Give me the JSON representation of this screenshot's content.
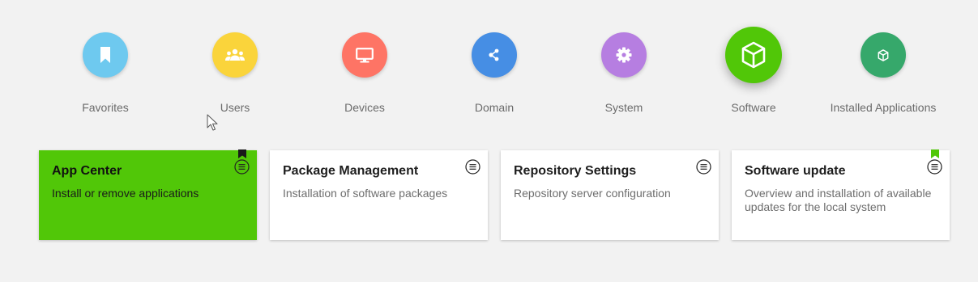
{
  "categories": [
    {
      "id": "favorites",
      "label": "Favorites",
      "color": "#6ec9ef",
      "icon": "bookmark-icon"
    },
    {
      "id": "users",
      "label": "Users",
      "color": "#fad43b",
      "icon": "users-icon"
    },
    {
      "id": "devices",
      "label": "Devices",
      "color": "#fe7465",
      "icon": "monitor-icon"
    },
    {
      "id": "domain",
      "label": "Domain",
      "color": "#468ee4",
      "icon": "network-icon"
    },
    {
      "id": "system",
      "label": "System",
      "color": "#b67ee1",
      "icon": "gear-icon"
    },
    {
      "id": "software",
      "label": "Software",
      "color": "#51c708",
      "icon": "cube-icon",
      "selected": true
    },
    {
      "id": "installed",
      "label": "Installed Applications",
      "color": "#36a86b",
      "icon": "cube-icon"
    }
  ],
  "tiles": [
    {
      "title": "App Center",
      "description": "Install or remove applications",
      "selected": true,
      "bookmark": "bookmark-icon-dark"
    },
    {
      "title": "Package Management",
      "description": "Installation of software packages"
    },
    {
      "title": "Repository Settings",
      "description": "Repository server configuration"
    },
    {
      "title": "Software update",
      "description": "Overview and installation of available updates for the local system",
      "bookmark": "bookmark-icon-green"
    }
  ],
  "colors": {
    "background": "#f2f2f2",
    "accent": "#51c708",
    "tile_bg": "#ffffff"
  }
}
